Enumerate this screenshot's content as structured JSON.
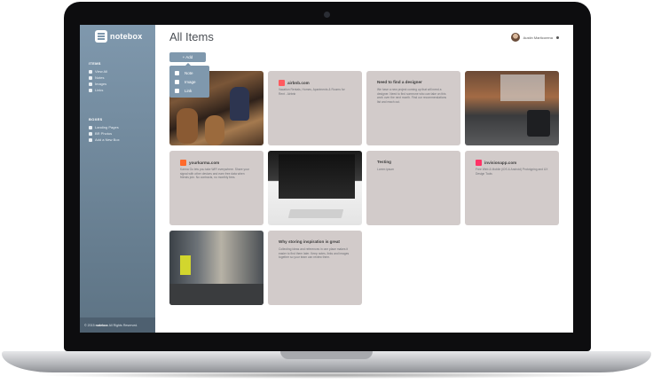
{
  "app": {
    "logo_text": "notebox"
  },
  "sidebar": {
    "items_title": "ITEMS",
    "items": [
      {
        "label": "View All",
        "icon": "grid-icon"
      },
      {
        "label": "Notes",
        "icon": "note-icon"
      },
      {
        "label": "Images",
        "icon": "image-icon"
      },
      {
        "label": "Links",
        "icon": "link-icon"
      }
    ],
    "boxes_title": "BOXES",
    "boxes": [
      {
        "label": "Landing Pages",
        "icon": "box-icon"
      },
      {
        "label": "BR Photos",
        "icon": "box-icon"
      },
      {
        "label": "Add a New Box",
        "icon": "plus-box-icon"
      }
    ],
    "footer_prefix": "© 2015",
    "footer_brand": "notebox",
    "footer_suffix": "All Rights Reserved."
  },
  "header": {
    "title": "All Items",
    "user_name": "Austin Marticorena"
  },
  "add_button": {
    "label": "+ Add"
  },
  "add_menu": [
    {
      "label": "Note",
      "icon": "note-icon"
    },
    {
      "label": "Image",
      "icon": "image-icon"
    },
    {
      "label": "Link",
      "icon": "link-icon"
    }
  ],
  "cards": [
    {
      "type": "image",
      "name": "bar-photo"
    },
    {
      "type": "link",
      "title": "airbnb.com",
      "body": "Vacation Rentals, Homes, Apartments & Rooms for Rent - Airbnb",
      "brand_color": "#ff5a5f"
    },
    {
      "type": "note",
      "title": "Need to find a designer",
      "body": "We have a new project coming up that will need a designer. Need to find someone who can take on this work over the next month. Find our recommendations list and reach out."
    },
    {
      "type": "image",
      "name": "office-photo"
    },
    {
      "type": "link",
      "title": "yourkarma.com",
      "body": "Karma Go lets you take WiFi everywhere. Share your signal with other devices and earn free data when friends join. No contracts, no monthly fees.",
      "brand_color": "#ff6a2b"
    },
    {
      "type": "image",
      "name": "desk-photo"
    },
    {
      "type": "note",
      "title": "Testing",
      "body": "Lorem ipsum"
    },
    {
      "type": "link",
      "title": "invisionapp.com",
      "body": "Free Web & Mobile (iOS & Android) Prototyping and UX Design Tools",
      "brand_color": "#ff3366"
    },
    {
      "type": "image",
      "name": "hallway-photo"
    },
    {
      "type": "note",
      "title": "Why storing inspiration is great",
      "body": "Collecting ideas and references in one place makes it easier to find them later. Keep notes, links and images together so your team can review them."
    }
  ]
}
